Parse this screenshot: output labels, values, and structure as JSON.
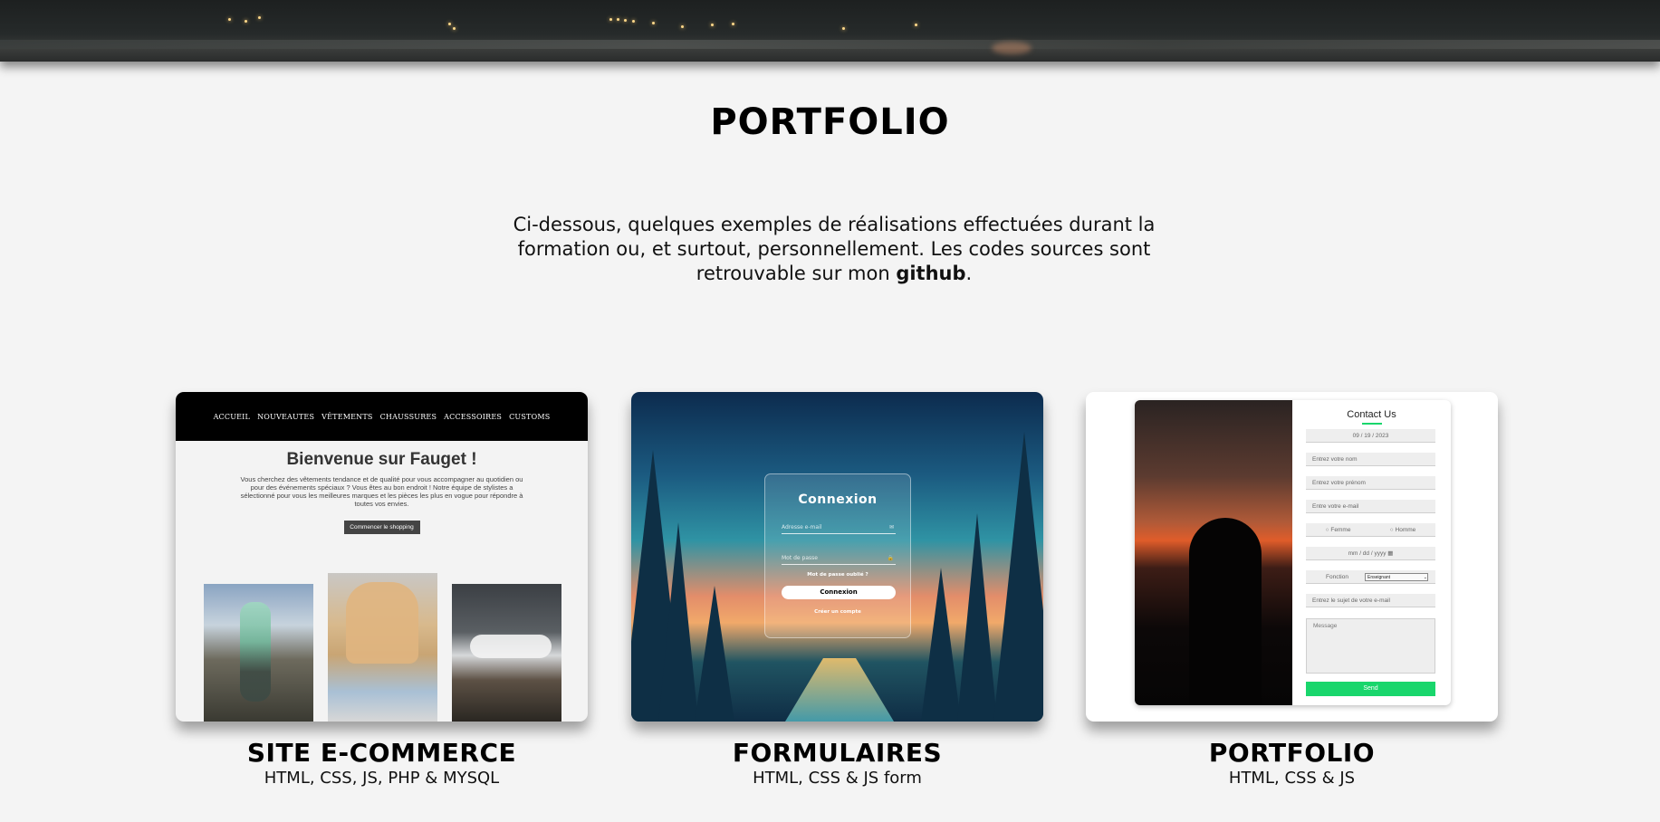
{
  "header": {
    "title": "PORTFOLIO"
  },
  "intro": {
    "text_before": "Ci-dessous, quelques exemples de réalisations effectuées durant la formation ou, et surtout, personnellement. Les codes sources sont retrouvable sur mon ",
    "link": "github",
    "text_after": "."
  },
  "projects": [
    {
      "title": "SITE E-COMMERCE",
      "tech": "HTML, CSS, JS, PHP & MYSQL",
      "preview": {
        "nav": [
          "ACCUEIL",
          "NOUVEAUTES",
          "VÊTEMENTS",
          "CHAUSSURES",
          "ACCESSOIRES",
          "CUSTOMS"
        ],
        "heading": "Bienvenue sur Fauget !",
        "description": "Vous cherchez des vêtements tendance et de qualité pour vous accompagner au quotidien ou pour des événements spéciaux ? Vous êtes au bon endroit ! Notre équipe de stylistes a sélectionné pour vous les meilleures marques et les pièces les plus en vogue pour répondre à toutes vos envies.",
        "button": "Commencer le shopping"
      }
    },
    {
      "title": "FORMULAIRES",
      "tech": "HTML, CSS & JS form",
      "preview": {
        "heading": "Connexion",
        "email_placeholder": "Adresse e-mail",
        "password_placeholder": "Mot de passe",
        "forgot": "Mot de passe oublié ?",
        "button": "Connexion",
        "create": "Créer un compte"
      }
    },
    {
      "title": "PORTFOLIO",
      "tech": "HTML, CSS & JS",
      "preview": {
        "heading": "Contact Us",
        "date_top": "09 / 19 / 2023",
        "name": "Entrez votre nom",
        "firstname": "Entrez votre prénom",
        "email": "Entre votre e-mail",
        "female": "Femme",
        "male": "Homme",
        "date": "mm / dd / yyyy",
        "function_label": "Fonction",
        "function_value": "Enseignant",
        "subject": "Entrez le sujet de votre e-mail",
        "message": "Message",
        "send": "Send"
      }
    }
  ],
  "colors": {
    "background": "#f4f4f4",
    "accent_green": "#19d66c"
  }
}
